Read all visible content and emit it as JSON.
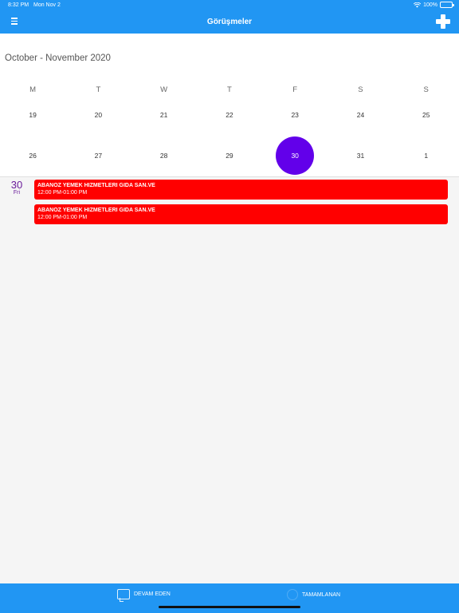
{
  "status": {
    "time": "8:32 PM",
    "date": "Mon Nov 2",
    "battery": "100%"
  },
  "header": {
    "title": "Görüşmeler",
    "menu_icon": "hamburger-menu-icon",
    "add_icon": "plus-icon"
  },
  "calendar": {
    "range": "October - November 2020",
    "weekdays": [
      "M",
      "T",
      "W",
      "T",
      "F",
      "S",
      "S"
    ],
    "weeks": [
      [
        "19",
        "20",
        "21",
        "22",
        "23",
        "24",
        "25"
      ],
      [
        "26",
        "27",
        "28",
        "29",
        "30",
        "31",
        "1"
      ]
    ],
    "selected": "30",
    "selected_color": "#6200ea"
  },
  "agenda": {
    "day": "30",
    "weekday": "Fri",
    "events": [
      {
        "title": "ABANOZ YEMEK HIZMETLERI GIDA SAN.VE",
        "time": "12:00 PM-01:00 PM",
        "color": "#ff0000"
      },
      {
        "title": "ABANOZ YEMEK HIZMETLERI GIDA SAN.VE",
        "time": "12:00 PM-01:00 PM",
        "color": "#ff0000"
      }
    ]
  },
  "tabs": [
    {
      "label": "DEVAM EDEN",
      "icon": "chat-icon"
    },
    {
      "label": "TAMAMLANAN",
      "icon": "check-circle-icon"
    }
  ],
  "colors": {
    "primary": "#2196f3",
    "accent": "#6200ea",
    "event": "#ff0000"
  }
}
